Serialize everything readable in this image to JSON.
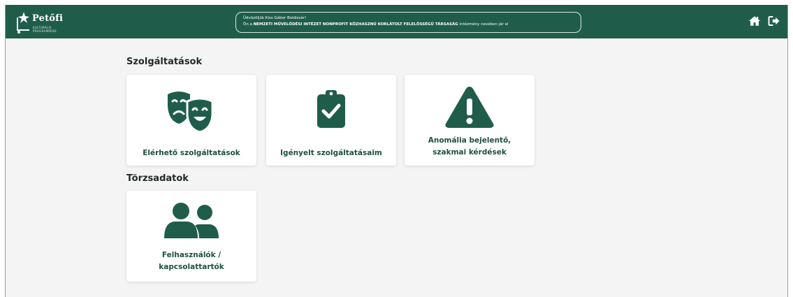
{
  "header": {
    "logo": {
      "brand": "Petőfi",
      "sub": "KULTURÁLIS PROGRAMIROD"
    },
    "greeting_line1": "Üdvözöljük Kiss Gábor Boldizsár!",
    "greeting_line2_prefix": "Ön a ",
    "greeting_org": "NEMZETI MŰVELŐDÉSI INTÉZET NONPROFIT KÖZHASZNÚ KORLÁTOLT FELELŐSSÉGŰ TÁRSASÁG",
    "greeting_line2_suffix": " intézmény nevében jár el",
    "icons": [
      "home-icon",
      "logout-icon"
    ]
  },
  "sections": {
    "services": {
      "title": "Szolgáltatások",
      "cards": [
        {
          "label": "Elérhető szolgáltatások",
          "icon": "theater-masks-icon"
        },
        {
          "label": "Igényelt szolgáltatásaim",
          "icon": "clipboard-check-icon"
        },
        {
          "label_line1": "Anomália bejelentő,",
          "label_line2": "szakmai kérdések",
          "icon": "warning-triangle-icon"
        }
      ]
    },
    "master_data": {
      "title": "Törzsadatok",
      "cards": [
        {
          "label_line1": "Felhasználók /",
          "label_line2": "kapcsolattartók",
          "icon": "users-icon"
        }
      ]
    }
  },
  "colors": {
    "primary": "#1f5d4a",
    "background": "#f4f4f4",
    "card": "#ffffff",
    "text_dark": "#1f2a27"
  }
}
